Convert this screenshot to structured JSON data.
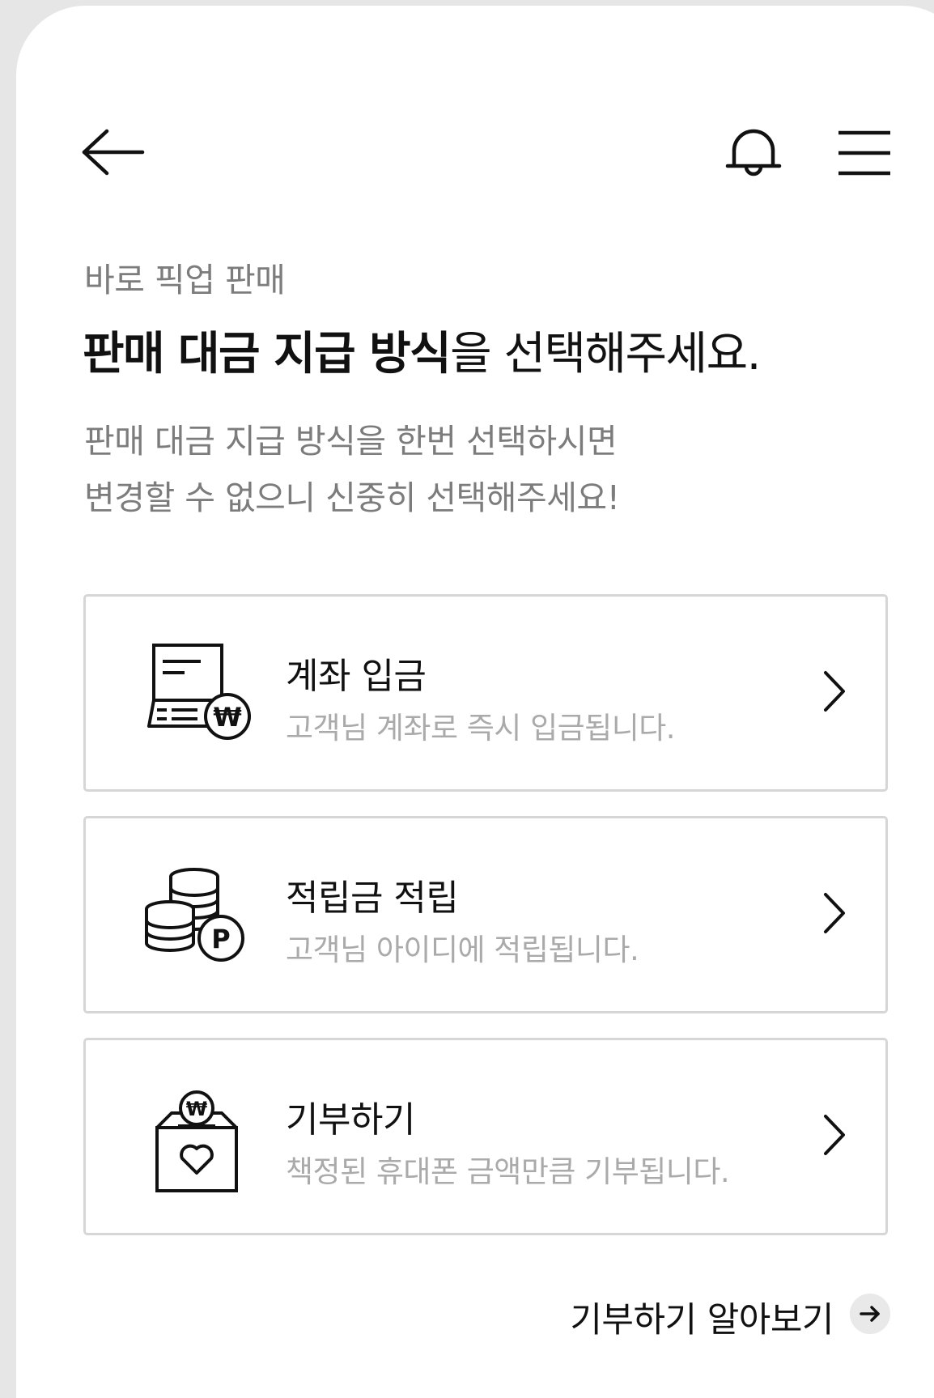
{
  "header": {
    "back_icon": "arrow-left-icon",
    "bell_icon": "bell-icon",
    "menu_icon": "hamburger-menu-icon"
  },
  "page": {
    "subtitle": "바로 픽업 판매",
    "headline_bold": "판매 대금 지급 방식",
    "headline_rest": "을 선택해주세요.",
    "description_line1": "판매 대금 지급 방식을 한번 선택하시면",
    "description_line2": "변경할 수 없으니 신중히 선택해주세요!"
  },
  "options": [
    {
      "title": "계좌 입금",
      "subtitle": "고객님 계좌로 즉시 입금됩니다.",
      "icon": "bank-transfer-icon",
      "badge_text": "₩"
    },
    {
      "title": "적립금 적립",
      "subtitle": "고객님 아이디에 적립됩니다.",
      "icon": "coin-points-icon",
      "badge_text": "P"
    },
    {
      "title": "기부하기",
      "subtitle": "책정된 휴대폰 금액만큼 기부됩니다.",
      "icon": "donation-box-icon",
      "badge_text": "₩"
    }
  ],
  "footer": {
    "learn_more_label": "기부하기 알아보기",
    "learn_more_icon": "arrow-right-icon"
  },
  "colors": {
    "background_outer": "#e6e6e6",
    "card_background": "#ffffff",
    "text_primary": "#111111",
    "text_secondary": "#7c7c7c",
    "text_muted": "#aaaaaa",
    "border": "#d6d6d6"
  }
}
